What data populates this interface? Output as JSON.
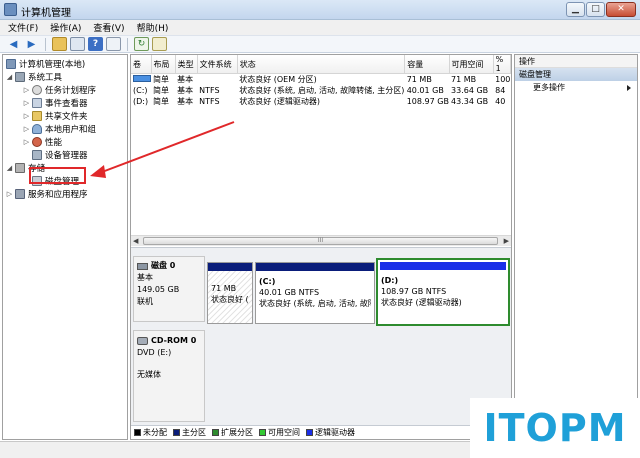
{
  "window": {
    "title": "计算机管理",
    "buttons": {
      "minimize": "▁",
      "maximize": "□",
      "close": "✕"
    }
  },
  "menu": [
    "文件(F)",
    "操作(A)",
    "查看(V)",
    "帮助(H)"
  ],
  "toolbar_icons": [
    "back-icon",
    "forward-icon",
    "folder-up-icon",
    "console-tree-icon",
    "help-icon",
    "properties-icon",
    "refresh-icon",
    "export-icon"
  ],
  "tree": {
    "root": "计算机管理(本地)",
    "system_tools": "系统工具",
    "task_scheduler": "任务计划程序",
    "event_viewer": "事件查看器",
    "shared_folders": "共享文件夹",
    "local_users": "本地用户和组",
    "performance": "性能",
    "device_manager": "设备管理器",
    "storage": "存储",
    "disk_management": "磁盘管理",
    "services": "服务和应用程序"
  },
  "table": {
    "headers": [
      "卷",
      "布局",
      "类型",
      "文件系统",
      "状态",
      "容量",
      "可用空间",
      "% 1"
    ],
    "rows": [
      [
        "",
        "简单",
        "基本",
        "",
        "状态良好 (OEM 分区)",
        "71 MB",
        "71 MB",
        "100"
      ],
      [
        "(C:)",
        "简单",
        "基本",
        "NTFS",
        "状态良好 (系统, 启动, 活动, 故障转储, 主分区)",
        "40.01 GB",
        "33.64 GB",
        "84"
      ],
      [
        "(D:)",
        "简单",
        "基本",
        "NTFS",
        "状态良好 (逻辑驱动器)",
        "108.97 GB",
        "43.34 GB",
        "40"
      ]
    ]
  },
  "scroll_label": "III",
  "disks": {
    "disk0": {
      "name": "磁盘 0",
      "type": "基本",
      "size": "149.05 GB",
      "status": "联机",
      "partitions": [
        {
          "label": "",
          "size": "71 MB",
          "status": "状态良好 (O"
        },
        {
          "label": "(C:)",
          "size": "40.01 GB NTFS",
          "status": "状态良好 (系统, 启动, 活动, 故障转"
        },
        {
          "label": "(D:)",
          "size": "108.97 GB NTFS",
          "status": "状态良好 (逻辑驱动器)"
        }
      ]
    },
    "cdrom0": {
      "name": "CD-ROM 0",
      "type": "DVD (E:)",
      "status": "无媒体"
    }
  },
  "legend": [
    {
      "label": "未分配",
      "color": "#000000"
    },
    {
      "label": "主分区",
      "color": "#0a1d7a"
    },
    {
      "label": "扩展分区",
      "color": "#2e8b2e"
    },
    {
      "label": "可用空间",
      "color": "#34c934"
    },
    {
      "label": "逻辑驱动器",
      "color": "#1a2ee8"
    }
  ],
  "actions": {
    "title": "操作",
    "section": "磁盘管理",
    "more": "更多操作"
  },
  "watermark": "ITOPM",
  "colors": {
    "primary_partition": "#0a1d7a",
    "logical_drive": "#1a2ee8",
    "selected_border": "#2e8b2e",
    "callout": "#e0282a",
    "watermark": "#1fa0d8"
  }
}
